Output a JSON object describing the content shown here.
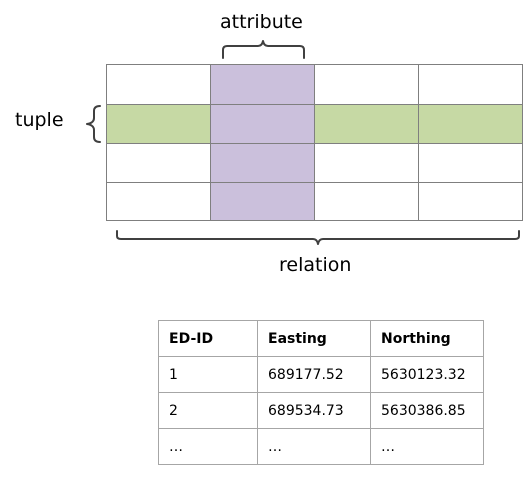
{
  "diagram": {
    "attribute_label": "attribute",
    "tuple_label": "tuple",
    "relation_label": "relation",
    "colors": {
      "attribute_column": "#cbc0dc",
      "tuple_row": "#c6d9a4",
      "grid_line": "#7f7f7f",
      "bracket": "#404040"
    },
    "grid": {
      "columns": 4,
      "rows": 4,
      "highlighted_column": 2,
      "highlighted_row": 2
    }
  },
  "table": {
    "headers": [
      "ED-ID",
      "Easting",
      "Northing"
    ],
    "rows": [
      [
        "1",
        "689177.52",
        "5630123.32"
      ],
      [
        "2",
        "689534.73",
        "5630386.85"
      ],
      [
        "…",
        "…",
        "…"
      ]
    ]
  }
}
